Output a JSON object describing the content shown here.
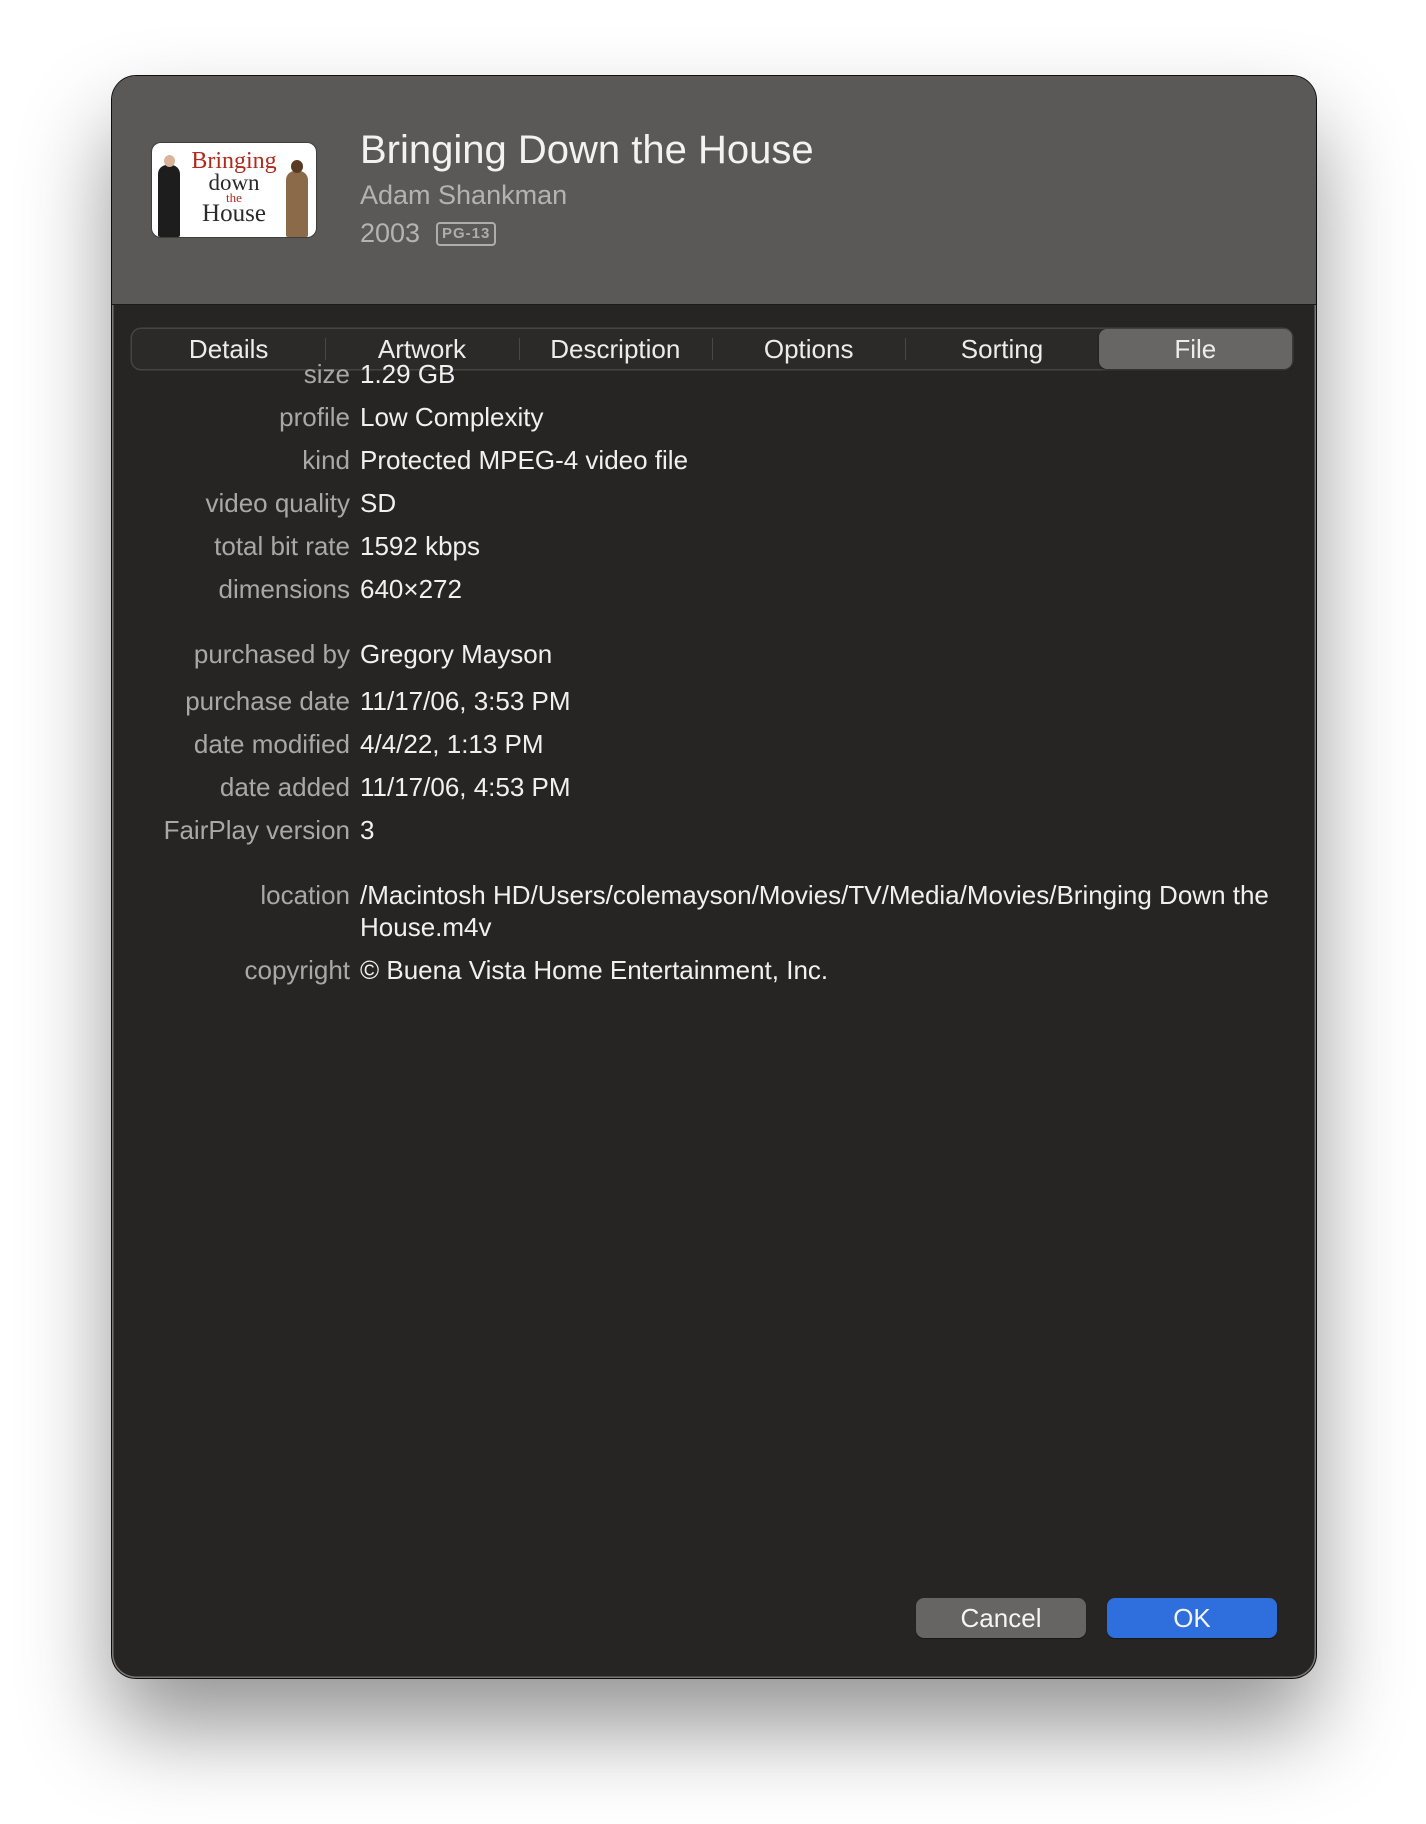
{
  "header": {
    "artwork_lines": [
      "Bringing",
      "down",
      "the",
      "House"
    ],
    "title": "Bringing Down the House",
    "director": "Adam Shankman",
    "year": "2003",
    "rating": "PG-13"
  },
  "tabs": [
    {
      "label": "Details",
      "selected": false
    },
    {
      "label": "Artwork",
      "selected": false
    },
    {
      "label": "Description",
      "selected": false
    },
    {
      "label": "Options",
      "selected": false
    },
    {
      "label": "Sorting",
      "selected": false
    },
    {
      "label": "File",
      "selected": true
    }
  ],
  "file_info": {
    "size": {
      "label": "size",
      "value": "1.29 GB"
    },
    "profile": {
      "label": "profile",
      "value": "Low Complexity"
    },
    "kind": {
      "label": "kind",
      "value": "Protected MPEG-4 video file"
    },
    "video_quality": {
      "label": "video quality",
      "value": "SD"
    },
    "total_bit_rate": {
      "label": "total bit rate",
      "value": "1592 kbps"
    },
    "dimensions": {
      "label": "dimensions",
      "value": "640×272"
    },
    "purchased_by": {
      "label": "purchased by",
      "value": "Gregory Mayson"
    },
    "purchase_date": {
      "label": "purchase date",
      "value": "11/17/06, 3:53 PM"
    },
    "date_modified": {
      "label": "date modified",
      "value": "4/4/22, 1:13 PM"
    },
    "date_added": {
      "label": "date added",
      "value": "11/17/06, 4:53 PM"
    },
    "fairplay_version": {
      "label": "FairPlay version",
      "value": "3"
    },
    "location": {
      "label": "location",
      "value": "/Macintosh HD/Users/colemayson/Movies/TV/Media/Movies/Bringing Down the House.m4v"
    },
    "copyright": {
      "label": "copyright",
      "value": "© Buena Vista Home Entertainment, Inc."
    }
  },
  "buttons": {
    "cancel": "Cancel",
    "ok": "OK"
  },
  "colors": {
    "window_bg": "#272524",
    "header_bg": "#5a5958",
    "accent": "#2f6fdd"
  }
}
